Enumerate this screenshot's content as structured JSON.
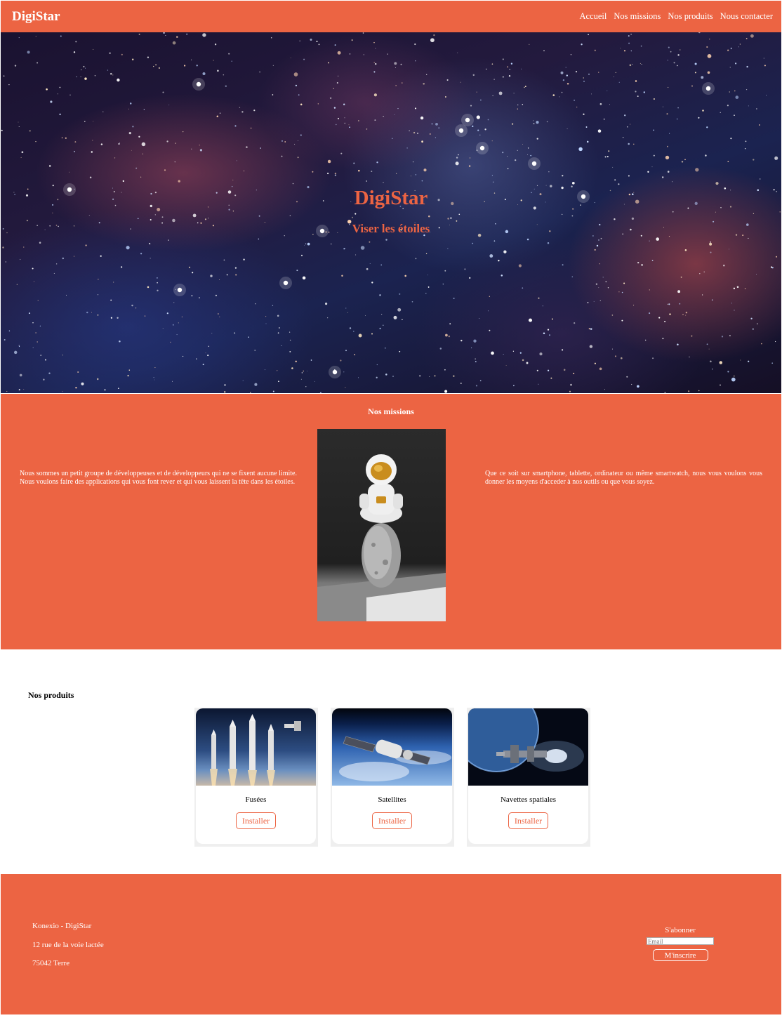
{
  "colors": {
    "accent": "#ec6443",
    "text_light": "#ffffff"
  },
  "navbar": {
    "brand": "DigiStar",
    "links": [
      "Accueil",
      "Nos missions",
      "Nos produits",
      "Nous contacter"
    ]
  },
  "hero": {
    "title": "DigiStar",
    "subtitle": "Viser les étoiles"
  },
  "missions": {
    "title": "Nos missions",
    "left_text": "Nous sommes un petit groupe de développeuses et de développeurs qui ne se fixent aucune limite. Nous voulons faire des applications qui vous font rever et qui vous laissent la tête dans les étoiles.",
    "right_text": "Que ce soit sur smartphone, tablette, ordinateur ou même smartwatch, nous vous voulons vous donner les moyens d'acceder à nos outils ou que vous soyez."
  },
  "products": {
    "title": "Nos produits",
    "items": [
      {
        "name": "Fusées",
        "button": "Installer"
      },
      {
        "name": "Satellites",
        "button": "Installer"
      },
      {
        "name": "Navettes spatiales",
        "button": "Installer"
      }
    ]
  },
  "footer": {
    "lines": [
      "Konexio - DigiStar",
      "12 rue de la voie lactée",
      "75042 Terre"
    ],
    "subscribe_label": "S'abonner",
    "email_placeholder": "Email",
    "subscribe_button": "M'inscrire"
  }
}
